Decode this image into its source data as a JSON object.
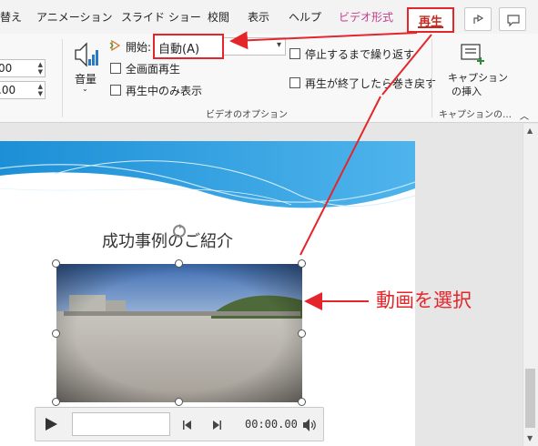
{
  "tabs": {
    "partial": "替え",
    "animations": "アニメーション",
    "slideshow": "スライド ショー",
    "review": "校閲",
    "view": "表示",
    "help": "ヘルプ",
    "video_format": "ビデオ形式",
    "playback": "再生"
  },
  "ribbon": {
    "spin_top_value": "00",
    "spin_bottom_value": ".00",
    "volume_label": "音量",
    "start_label": "開始:",
    "start_value": "自動(A)",
    "fullscreen_label": "全画面再生",
    "hide_label": "再生中のみ表示",
    "loop_label": "停止するまで繰り返す",
    "rewind_label": "再生が終了したら巻き戻す",
    "caption_line1": "キャプション",
    "caption_line2": "の挿入",
    "group_video_options": "ビデオのオプション",
    "group_captions": "キャプションの…"
  },
  "slide": {
    "title": "成功事例のご紹介"
  },
  "player": {
    "time": "00:00.00"
  },
  "callout": {
    "text": "動画を選択"
  },
  "colors": {
    "accent_red": "#e4262a",
    "video_tab": "#c43b8a",
    "slide_wave": "#2a9bdc"
  }
}
